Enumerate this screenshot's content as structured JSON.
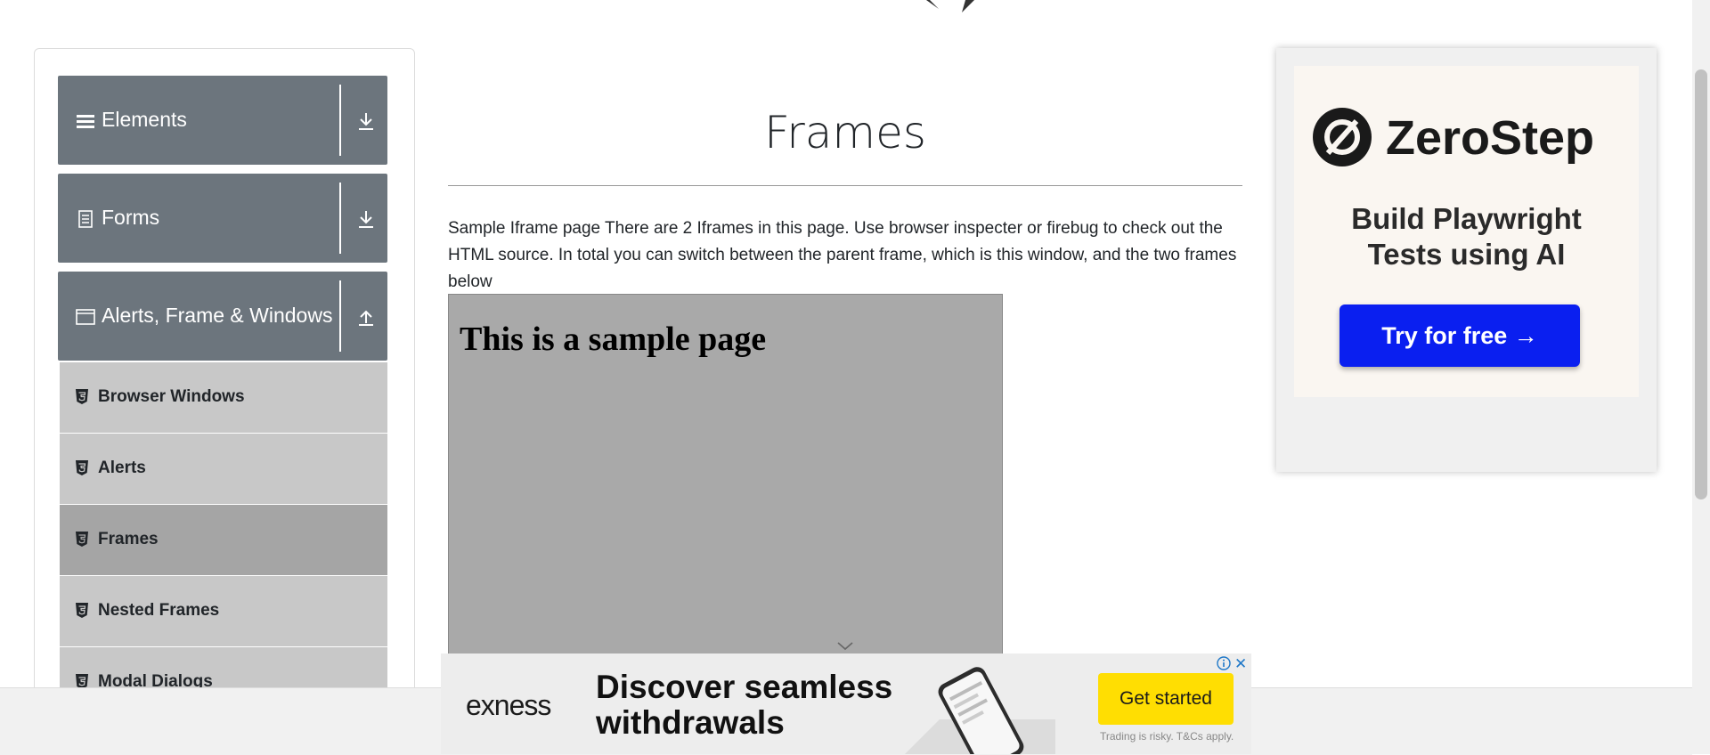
{
  "sidebar": {
    "groups": [
      {
        "title": "Elements",
        "icon": "hamburger-icon",
        "arrow": "download-icon"
      },
      {
        "title": "Forms",
        "icon": "document-icon",
        "arrow": "download-icon"
      },
      {
        "title": "Alerts, Frame & Windows",
        "icon": "window-icon",
        "arrow": "upload-icon"
      }
    ],
    "items": [
      {
        "label": "Browser Windows",
        "icon": "html5-icon"
      },
      {
        "label": "Alerts",
        "icon": "html5-icon"
      },
      {
        "label": "Frames",
        "icon": "html5-icon",
        "active": true
      },
      {
        "label": "Nested Frames",
        "icon": "html5-icon"
      },
      {
        "label": "Modal Dialogs",
        "icon": "html5-icon"
      }
    ]
  },
  "main": {
    "title": "Frames",
    "description": "Sample Iframe page There are 2 Iframes in this page. Use browser inspecter or firebug to check out the HTML source. In total you can switch between the parent frame, which is this window, and the two frames below",
    "iframe_heading": "This is a sample page"
  },
  "ad_right": {
    "brand": "ZeroStep",
    "tagline_line1": "Build Playwright",
    "tagline_line2": "Tests using AI",
    "cta": "Try for free →",
    "colors": {
      "button": "#0a1ff0"
    }
  },
  "bottom_banner": {
    "brand": "exness",
    "headline_line1": "Discover seamless",
    "headline_line2": "withdrawals",
    "cta": "Get started",
    "disclaimer": "Trading is risky. T&Cs apply.",
    "close_symbol": "✕",
    "colors": {
      "cta": "#ffde02"
    }
  }
}
